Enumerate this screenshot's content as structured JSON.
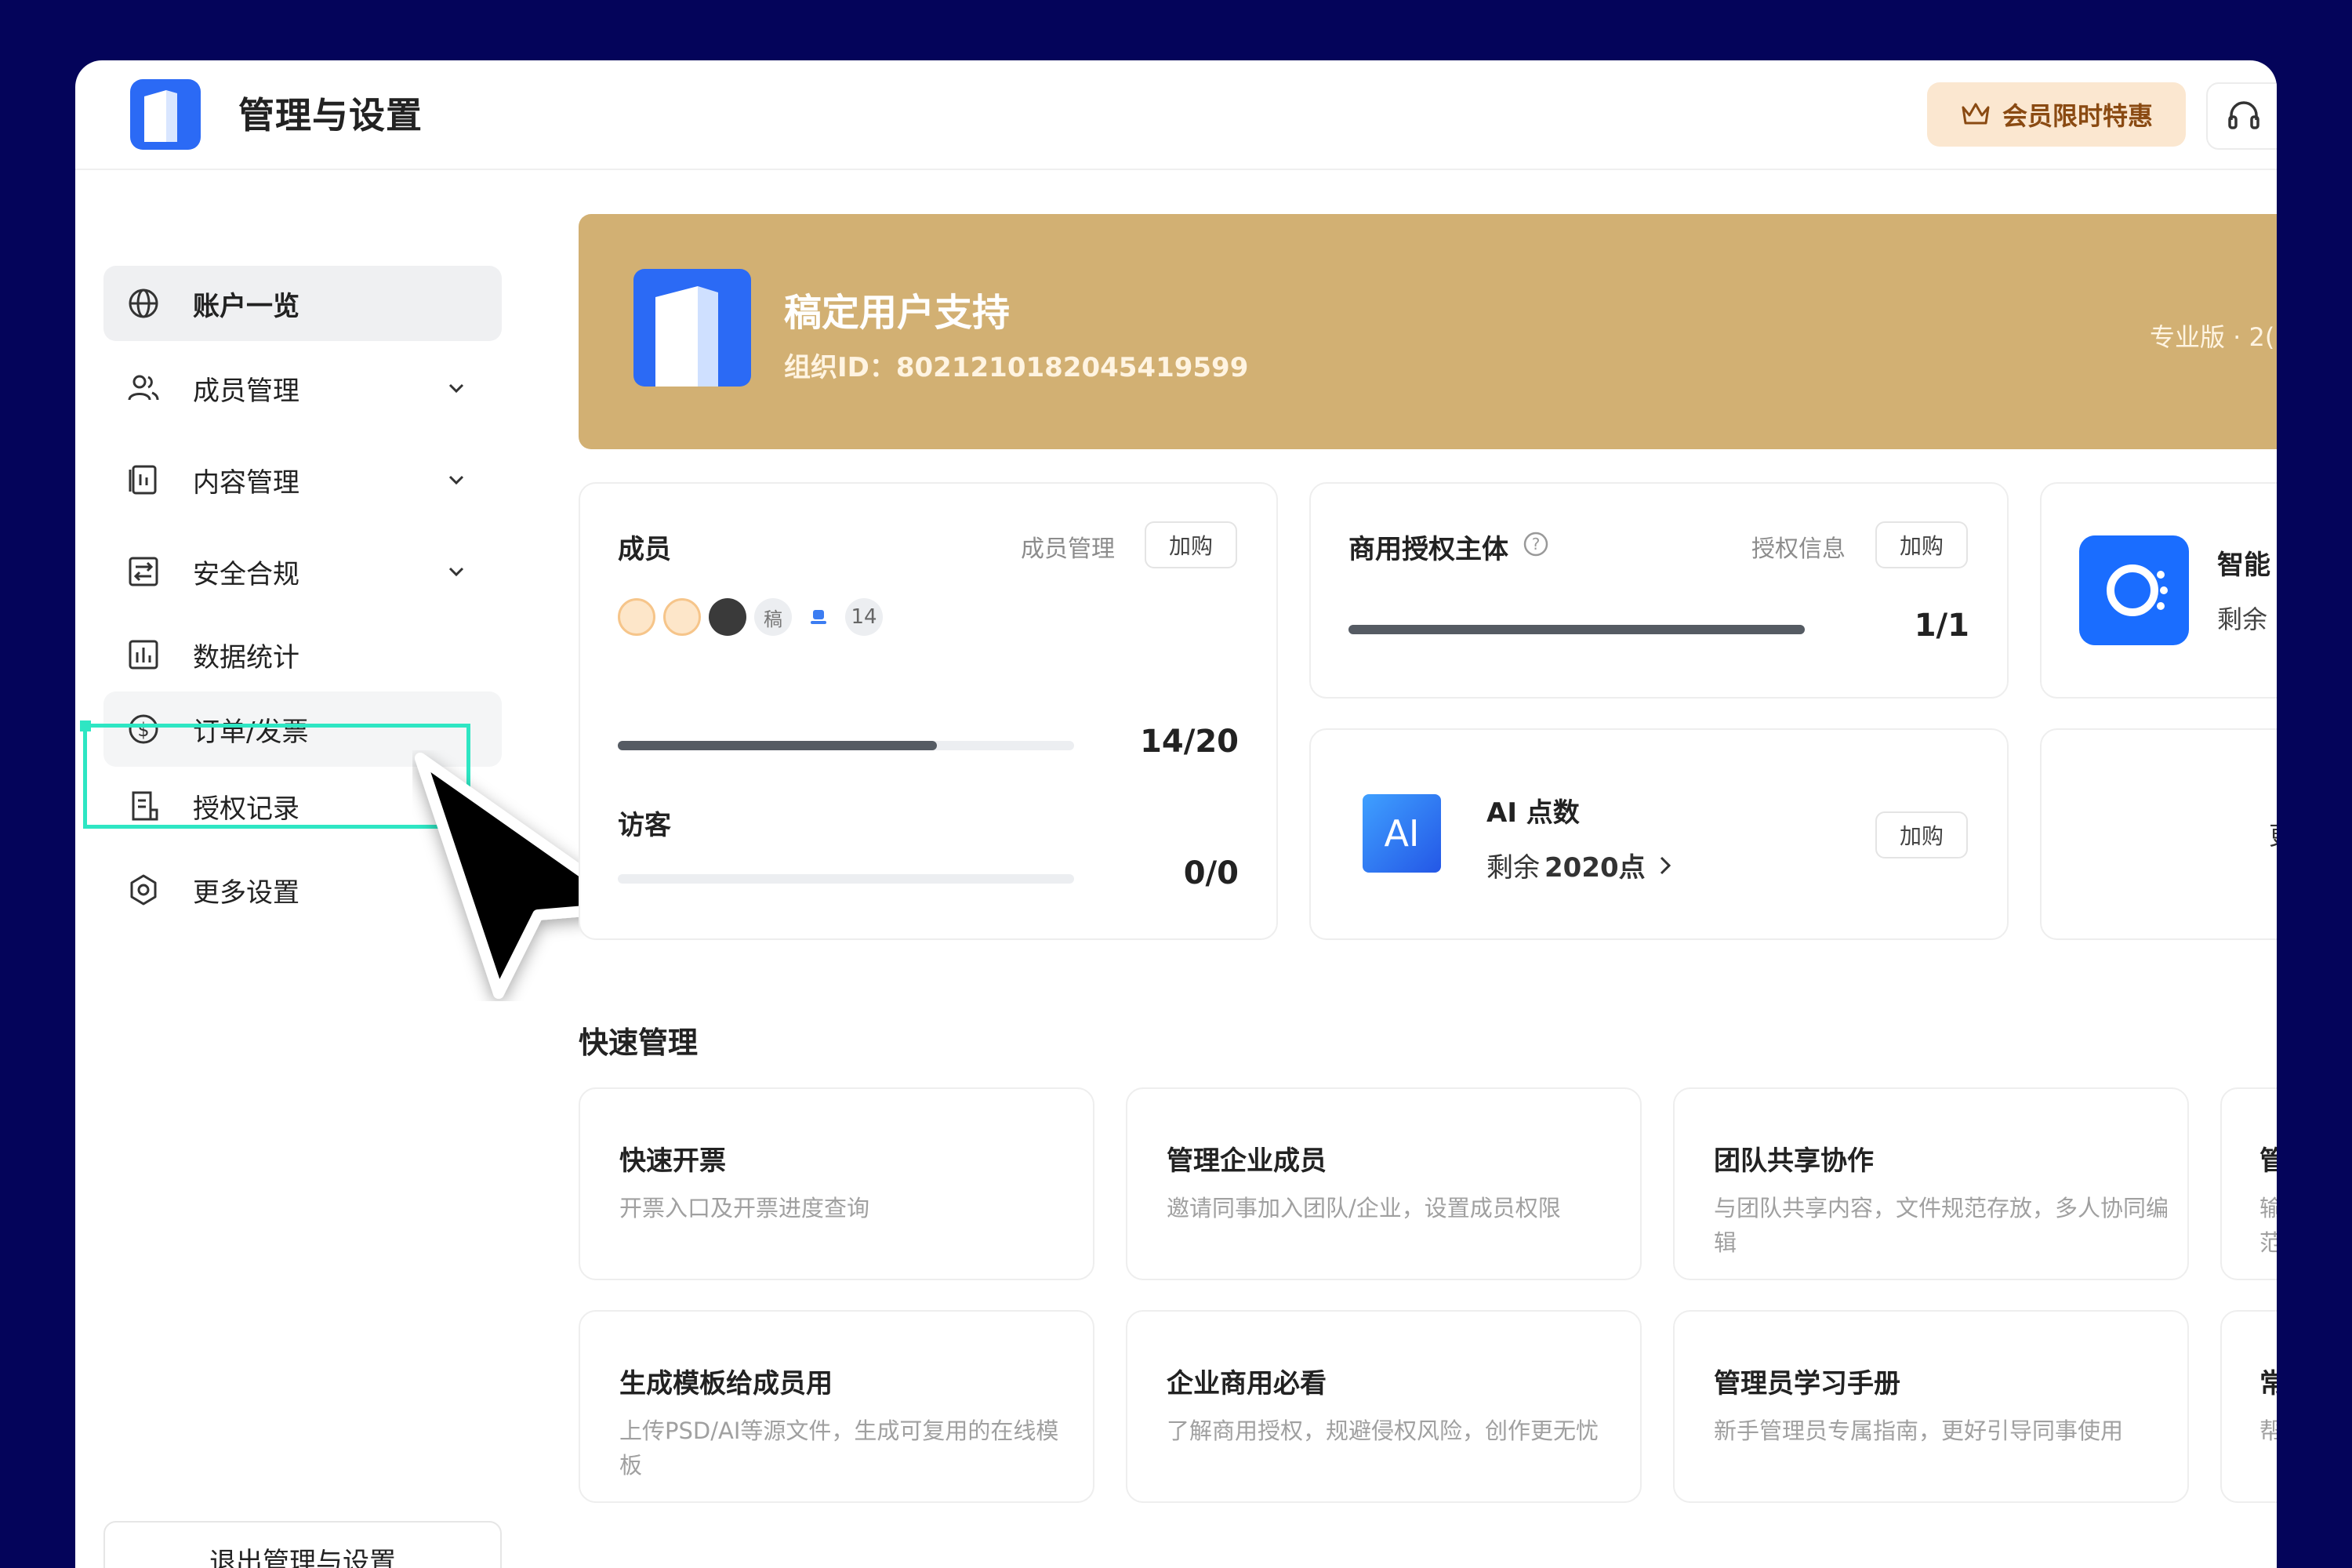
{
  "header": {
    "title": "管理与设置",
    "promo_label": "会员限时特惠"
  },
  "sidebar": {
    "items": [
      {
        "label": "账户一览"
      },
      {
        "label": "成员管理"
      },
      {
        "label": "内容管理"
      },
      {
        "label": "安全合规"
      },
      {
        "label": "数据统计"
      },
      {
        "label": "订单/发票"
      },
      {
        "label": "授权记录"
      },
      {
        "label": "更多设置"
      }
    ],
    "exit_label": "退出管理与设置"
  },
  "banner": {
    "org_name": "稿定用户支持",
    "org_id": "组织ID：8021210182045419599",
    "plan": "专业版 · 2("
  },
  "members_card": {
    "title": "成员",
    "manage_link": "成员管理",
    "buy_label": "加购",
    "avatar_text": "稿",
    "avatar_count": "14",
    "count": "14/20",
    "fill_fraction": 0.7,
    "visitor_title": "访客",
    "visitor_count": "0/0",
    "visitor_fraction": 0
  },
  "license_card": {
    "title": "商用授权主体",
    "info_link": "授权信息",
    "buy_label": "加购",
    "count": "1/1",
    "fill_fraction": 1.0
  },
  "smart_card": {
    "title": "智能",
    "subtitle": "剩余"
  },
  "ai_card": {
    "icon_text": "AI",
    "title": "AI 点数",
    "remaining_prefix": "剩余 ",
    "remaining_value": "2020点",
    "buy_label": "加购"
  },
  "partial_card": {
    "text": "更"
  },
  "quick": {
    "section_title": "快速管理",
    "cards": [
      {
        "title": "快速开票",
        "desc": "开票入口及开票进度查询"
      },
      {
        "title": "管理企业成员",
        "desc": "邀请同事加入团队/企业，设置成员权限"
      },
      {
        "title": "团队共享协作",
        "desc": "与团队共享内容，文件规范存放，多人协同编辑"
      },
      {
        "title": "管",
        "desc": "输范"
      },
      {
        "title": "生成模板给成员用",
        "desc": "上传PSD/AI等源文件，生成可复用的在线模板"
      },
      {
        "title": "企业商用必看",
        "desc": "了解商用授权，规避侵权风险，创作更无忧"
      },
      {
        "title": "管理员学习手册",
        "desc": "新手管理员专属指南，更好引导同事使用"
      },
      {
        "title": "常",
        "desc": "帮"
      }
    ]
  },
  "colors": {
    "background": "#04045a",
    "banner": "#d2b073",
    "highlight": "#2ee6c3",
    "brand_blue": "#1a6dff"
  }
}
